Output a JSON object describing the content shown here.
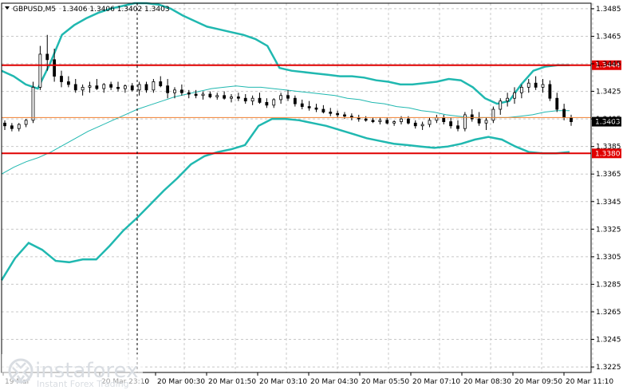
{
  "window": {
    "symbol": "GBPUSD,M5",
    "ohlc": "1.3406 1.3406 1.3402 1.3403"
  },
  "chart_data": {
    "type": "candlestick",
    "y_ticks": [
      "1.3485",
      "1.3465",
      "1.3445",
      "1.3425",
      "1.3405",
      "1.3385",
      "1.3365",
      "1.3345",
      "1.3325",
      "1.3305",
      "1.3285",
      "1.3265",
      "1.3245",
      "1.3225"
    ],
    "ylim": [
      1.3221,
      1.3489
    ],
    "x_ticks": [
      "19 Mar",
      "20 Mar 23:10",
      "20 Mar 00:30",
      "20 Mar 01:50",
      "20 Mar 03:10",
      "20 Mar 04:30",
      "20 Mar 05:50",
      "20 Mar 07:10",
      "20 Mar 08:30",
      "20 Mar 09:50",
      "20 Mar 11:10"
    ],
    "levels": [
      {
        "value": 1.3444,
        "label": "1.3444",
        "color": "#e00000"
      },
      {
        "value": 1.338,
        "label": "1.3380",
        "color": "#e00000"
      }
    ],
    "current_price": {
      "value": 1.3403,
      "label": "1.3403",
      "line_value": 1.3406,
      "color": "#f08030"
    },
    "bands_color": "#20b8b0",
    "ma_color": "#20b8b0",
    "bands": {
      "upper": [
        [
          1.344,
          1.3436,
          1.343,
          1.3427,
          1.3445,
          1.3466,
          1.3473,
          1.3478,
          1.3482,
          1.3485,
          1.3487,
          1.3489,
          1.3489,
          1.3488,
          1.3485,
          1.348,
          1.3476,
          1.3472,
          1.347,
          1.3468,
          1.3466,
          1.3463,
          1.3458,
          1.3442,
          1.344,
          1.3439,
          1.3438,
          1.3437,
          1.3436,
          1.3436,
          1.3435,
          1.3433,
          1.3432,
          1.343,
          1.343,
          1.3431,
          1.3432,
          1.3434,
          1.3433,
          1.3428,
          1.342,
          1.3416,
          1.3418,
          1.343,
          1.344,
          1.3443,
          1.3444,
          1.3444
        ]
      ],
      "lower": [
        [
          1.3288,
          1.3304,
          1.3315,
          1.331,
          1.3302,
          1.3301,
          1.3303,
          1.3303,
          1.3313,
          1.3324,
          1.3333,
          1.3343,
          1.3353,
          1.3362,
          1.3372,
          1.3378,
          1.3381,
          1.3383,
          1.3386,
          1.34,
          1.3405,
          1.3405,
          1.3404,
          1.3402,
          1.34,
          1.3397,
          1.3394,
          1.3391,
          1.3389,
          1.3387,
          1.3386,
          1.3385,
          1.3384,
          1.3385,
          1.3387,
          1.339,
          1.3392,
          1.339,
          1.3385,
          1.3381,
          1.338,
          1.338,
          1.3381
        ]
      ],
      "middle": [
        [
          1.3365,
          1.337,
          1.3374,
          1.3377,
          1.3381,
          1.3386,
          1.3391,
          1.3396,
          1.34,
          1.3404,
          1.3408,
          1.3412,
          1.3415,
          1.3418,
          1.3421,
          1.3423,
          1.3425,
          1.3427,
          1.3428,
          1.3429,
          1.3428,
          1.3428,
          1.3427,
          1.3426,
          1.3425,
          1.3424,
          1.3423,
          1.3422,
          1.342,
          1.3419,
          1.3417,
          1.3416,
          1.3414,
          1.3413,
          1.3411,
          1.341,
          1.3408,
          1.3407,
          1.3406,
          1.3406,
          1.3406,
          1.3406,
          1.3407,
          1.3408,
          1.341,
          1.3411,
          1.3411
        ]
      ]
    },
    "candles": [
      [
        1.3402,
        1.3404,
        1.3397,
        1.34
      ],
      [
        1.34,
        1.3402,
        1.3396,
        1.3398
      ],
      [
        1.3398,
        1.3402,
        1.3396,
        1.3401
      ],
      [
        1.3401,
        1.3405,
        1.3399,
        1.3404
      ],
      [
        1.3404,
        1.3432,
        1.3402,
        1.3428
      ],
      [
        1.3428,
        1.3458,
        1.3426,
        1.3452
      ],
      [
        1.3452,
        1.3466,
        1.344,
        1.3448
      ],
      [
        1.3448,
        1.3456,
        1.3432,
        1.3436
      ],
      [
        1.3436,
        1.344,
        1.3428,
        1.3432
      ],
      [
        1.3432,
        1.3436,
        1.3428,
        1.343
      ],
      [
        1.343,
        1.3434,
        1.3424,
        1.3426
      ],
      [
        1.3426,
        1.343,
        1.3422,
        1.3428
      ],
      [
        1.3428,
        1.3432,
        1.3424,
        1.3429
      ],
      [
        1.3429,
        1.3434,
        1.3426,
        1.3427
      ],
      [
        1.3427,
        1.3431,
        1.3424,
        1.343
      ],
      [
        1.343,
        1.3432,
        1.3426,
        1.3428
      ],
      [
        1.3428,
        1.3432,
        1.3425,
        1.3427
      ],
      [
        1.3427,
        1.343,
        1.3424,
        1.3429
      ],
      [
        1.3429,
        1.3431,
        1.3425,
        1.3426
      ],
      [
        1.3426,
        1.3432,
        1.3422,
        1.343
      ],
      [
        1.343,
        1.3432,
        1.3424,
        1.3426
      ],
      [
        1.3426,
        1.3434,
        1.3424,
        1.3432
      ],
      [
        1.3432,
        1.3436,
        1.3428,
        1.3429
      ],
      [
        1.3429,
        1.3434,
        1.342,
        1.3424
      ],
      [
        1.3424,
        1.3428,
        1.342,
        1.3426
      ],
      [
        1.3426,
        1.343,
        1.3422,
        1.3424
      ],
      [
        1.3424,
        1.3426,
        1.342,
        1.3423
      ],
      [
        1.3423,
        1.3426,
        1.342,
        1.3422
      ],
      [
        1.3422,
        1.3425,
        1.3419,
        1.3423
      ],
      [
        1.3423,
        1.3425,
        1.342,
        1.3421
      ],
      [
        1.3421,
        1.3424,
        1.3419,
        1.3422
      ],
      [
        1.3422,
        1.3425,
        1.3419,
        1.342
      ],
      [
        1.342,
        1.3423,
        1.3417,
        1.3421
      ],
      [
        1.3421,
        1.3424,
        1.3418,
        1.342
      ],
      [
        1.342,
        1.3423,
        1.3416,
        1.3418
      ],
      [
        1.3418,
        1.3422,
        1.3415,
        1.342
      ],
      [
        1.342,
        1.3424,
        1.3416,
        1.3417
      ],
      [
        1.3417,
        1.342,
        1.3413,
        1.3415
      ],
      [
        1.3415,
        1.342,
        1.3413,
        1.3419
      ],
      [
        1.3419,
        1.3424,
        1.3416,
        1.3422
      ],
      [
        1.3422,
        1.3426,
        1.3418,
        1.342
      ],
      [
        1.342,
        1.3422,
        1.3414,
        1.3416
      ],
      [
        1.3416,
        1.3419,
        1.3412,
        1.3414
      ],
      [
        1.3414,
        1.3418,
        1.3411,
        1.3413
      ],
      [
        1.3413,
        1.3416,
        1.341,
        1.3412
      ],
      [
        1.3412,
        1.3415,
        1.3409,
        1.341
      ],
      [
        1.341,
        1.3413,
        1.3407,
        1.3409
      ],
      [
        1.3409,
        1.3411,
        1.3406,
        1.3408
      ],
      [
        1.3408,
        1.341,
        1.3405,
        1.3407
      ],
      [
        1.3407,
        1.3409,
        1.3404,
        1.3406
      ],
      [
        1.3406,
        1.3408,
        1.3403,
        1.3405
      ],
      [
        1.3405,
        1.3407,
        1.3403,
        1.3404
      ],
      [
        1.3404,
        1.3406,
        1.3402,
        1.3403
      ],
      [
        1.3403,
        1.3406,
        1.3401,
        1.3404
      ],
      [
        1.3404,
        1.3406,
        1.3401,
        1.3402
      ],
      [
        1.3402,
        1.3404,
        1.34,
        1.3403
      ],
      [
        1.3403,
        1.3407,
        1.3401,
        1.3405
      ],
      [
        1.3405,
        1.3407,
        1.3401,
        1.3402
      ],
      [
        1.3402,
        1.3404,
        1.3398,
        1.34
      ],
      [
        1.34,
        1.3403,
        1.3397,
        1.3401
      ],
      [
        1.3401,
        1.3406,
        1.3399,
        1.3404
      ],
      [
        1.3404,
        1.3408,
        1.3402,
        1.3406
      ],
      [
        1.3406,
        1.3408,
        1.3401,
        1.3403
      ],
      [
        1.3403,
        1.3406,
        1.3398,
        1.34
      ],
      [
        1.34,
        1.3404,
        1.3396,
        1.3398
      ],
      [
        1.3398,
        1.341,
        1.3396,
        1.3408
      ],
      [
        1.3408,
        1.3412,
        1.3403,
        1.3405
      ],
      [
        1.3405,
        1.341,
        1.34,
        1.3402
      ],
      [
        1.3402,
        1.3406,
        1.3397,
        1.3404
      ],
      [
        1.3404,
        1.3414,
        1.3402,
        1.3412
      ],
      [
        1.3412,
        1.342,
        1.3408,
        1.3418
      ],
      [
        1.3418,
        1.3424,
        1.3414,
        1.342
      ],
      [
        1.342,
        1.3428,
        1.3416,
        1.3424
      ],
      [
        1.3424,
        1.343,
        1.342,
        1.3428
      ],
      [
        1.3428,
        1.3434,
        1.3424,
        1.3431
      ],
      [
        1.3431,
        1.3436,
        1.3426,
        1.3428
      ],
      [
        1.3428,
        1.3434,
        1.3424,
        1.343
      ],
      [
        1.343,
        1.3433,
        1.3418,
        1.342
      ],
      [
        1.342,
        1.3424,
        1.341,
        1.3412
      ],
      [
        1.3412,
        1.3416,
        1.3404,
        1.3406
      ],
      [
        1.3406,
        1.3408,
        1.34,
        1.3403
      ]
    ]
  },
  "watermark": {
    "brand": "instaforex",
    "tagline": "Instant Forex Trading"
  }
}
